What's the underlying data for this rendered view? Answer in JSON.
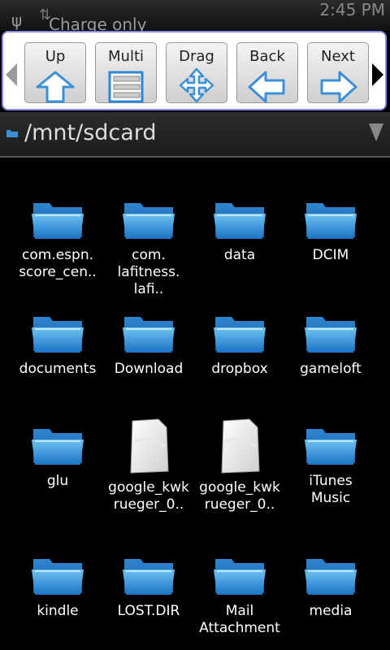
{
  "status_bar": {
    "notification": "Charge only",
    "time": "2:45 PM"
  },
  "toolbar": {
    "buttons": [
      {
        "label": "Up",
        "icon": "up-arrow-icon"
      },
      {
        "label": "Multi",
        "icon": "multi-select-icon"
      },
      {
        "label": "Drag",
        "icon": "drag-move-icon"
      },
      {
        "label": "Back",
        "icon": "back-arrow-icon"
      },
      {
        "label": "Next",
        "icon": "next-arrow-icon"
      }
    ]
  },
  "path_bar": {
    "path": "/mnt/sdcard"
  },
  "files": [
    {
      "name": "com.espn.\nscore_cen..",
      "type": "folder"
    },
    {
      "name": "com.\nlafitness.\nlafi..",
      "type": "folder"
    },
    {
      "name": "data",
      "type": "folder"
    },
    {
      "name": "DCIM",
      "type": "folder"
    },
    {
      "name": "documents",
      "type": "folder"
    },
    {
      "name": "Download",
      "type": "folder"
    },
    {
      "name": "dropbox",
      "type": "folder"
    },
    {
      "name": "gameloft",
      "type": "folder"
    },
    {
      "name": "glu",
      "type": "folder"
    },
    {
      "name": "google_kwk\nrueger_0..",
      "type": "file"
    },
    {
      "name": "google_kwk\nrueger_0..",
      "type": "file"
    },
    {
      "name": "iTunes\nMusic",
      "type": "folder"
    },
    {
      "name": "kindle",
      "type": "folder"
    },
    {
      "name": "LOST.DIR",
      "type": "folder"
    },
    {
      "name": "Mail\nAttachment",
      "type": "folder"
    },
    {
      "name": "media",
      "type": "folder"
    }
  ],
  "colors": {
    "folder_top": "#6ec4f2",
    "folder_bottom": "#1b72c4",
    "toolbar_border": "#8a8ae6"
  }
}
